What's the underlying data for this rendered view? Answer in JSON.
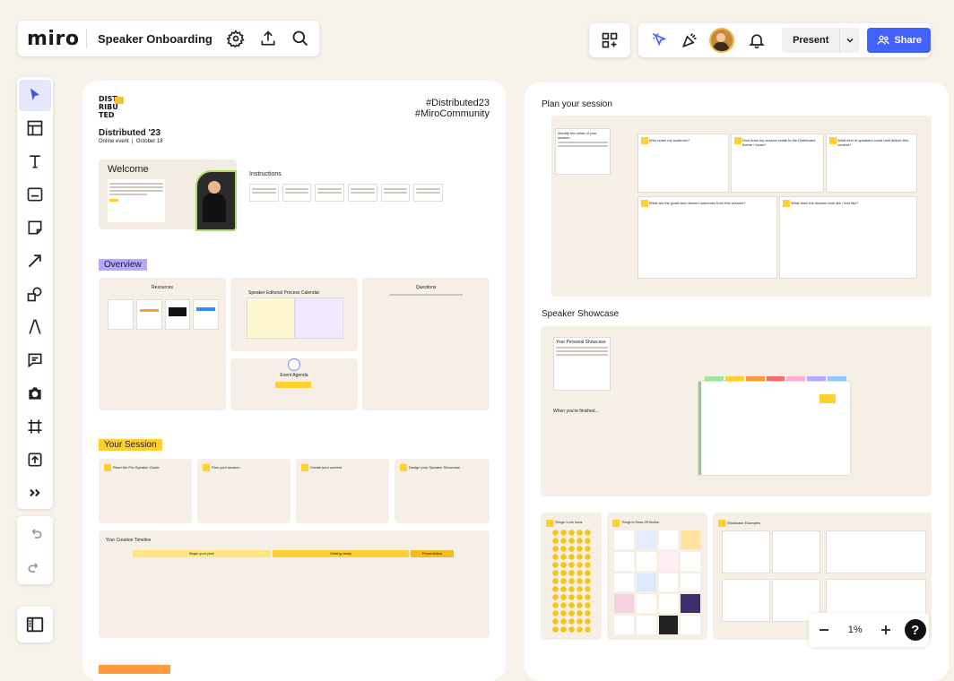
{
  "app": {
    "logo": "miro",
    "board_title": "Speaker Onboarding",
    "accent": "#4262ff"
  },
  "topbar": {
    "present_label": "Present",
    "share_label": "Share"
  },
  "zoom": {
    "level": "1%"
  },
  "board": {
    "left": {
      "logo_text": "DIST\nRIBU\nTED",
      "event_title": "Distributed '23",
      "event_subtitle": "Online event  |  October 18",
      "hashtag_1": "#Distributed23",
      "hashtag_2": "#MiroCommunity",
      "welcome_title": "Welcome",
      "instructions_title": "Instructions",
      "overview_label": "Overview",
      "resources_title": "Resources",
      "calendar_title": "Speaker Editorial Process Calendar",
      "questions_title": "Questions",
      "agenda_title": "Event Agenda",
      "your_session_label": "Your Session",
      "creation_timeline_title": "Your Creation Timeline",
      "timeline_phases": [
        "Begin your plan",
        "Getting ready",
        "Presentation"
      ],
      "session_cards": [
        "Read the Pre-Speaker Guide",
        "Plan your session",
        "Create your content",
        "Design your Speaker Showcase"
      ]
    },
    "right": {
      "plan_title": "Plan your session",
      "identify_title": "Identify the value of your session",
      "plan_questions": [
        "Who is/are my audience?",
        "How does my session relate to the Distributed theme / focus?",
        "What kind of speakers could best deliver this content?",
        "What are the goals and desired outcomes from this session?",
        "What does the session look like / feel like?"
      ],
      "showcase_title": "Speaker Showcase",
      "personal_showcase_title": "Your Personal Showcase",
      "when_finished": "When you're finished...",
      "things_love_title": "Things I Love Icons",
      "favorite_things_title": "Things to Show Off Section",
      "showcase_examples_title": "Showcase Examples"
    }
  }
}
